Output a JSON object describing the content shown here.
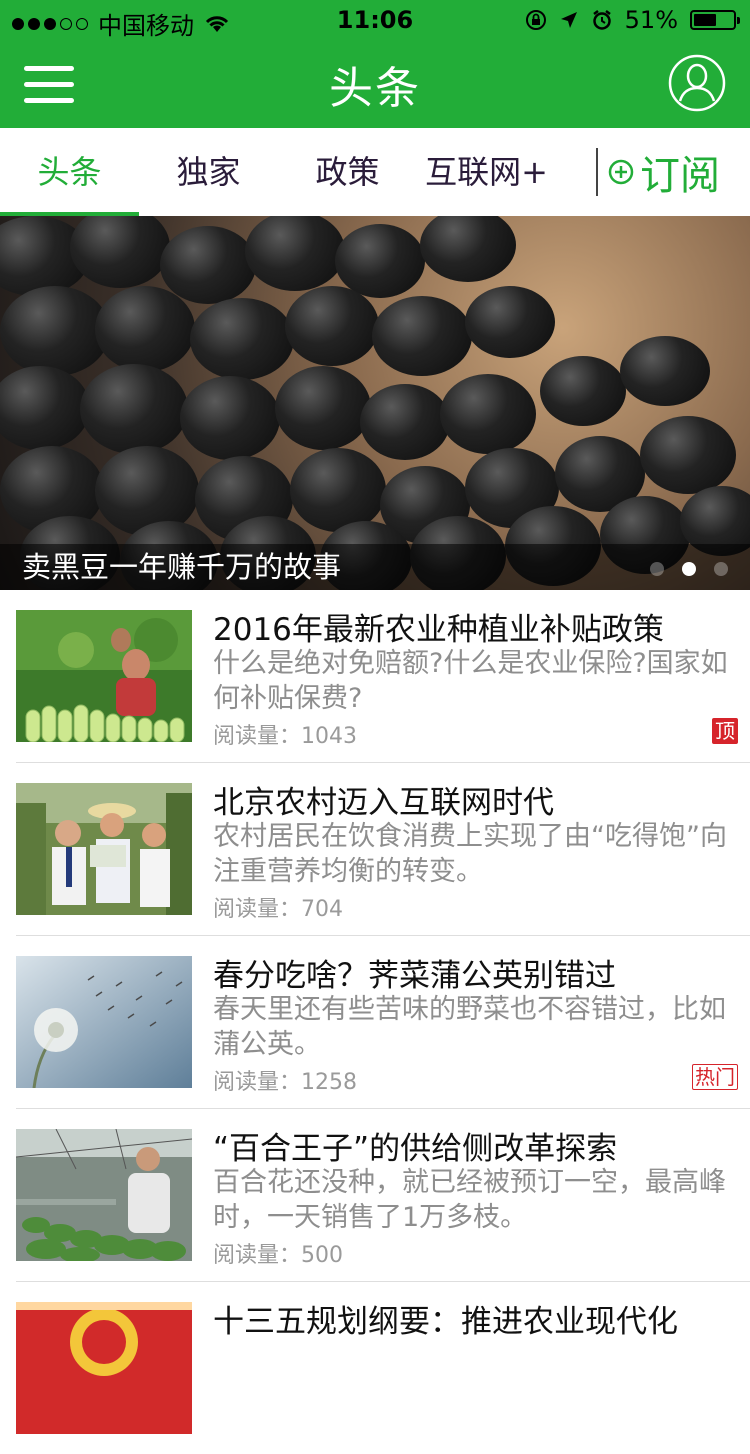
{
  "status": {
    "carrier": "中国移动",
    "time": "11:06",
    "battery": "51%"
  },
  "nav": {
    "title": "头条"
  },
  "tabs": [
    {
      "label": "头条",
      "active": true
    },
    {
      "label": "独家",
      "active": false
    },
    {
      "label": "政策",
      "active": false
    },
    {
      "label": "互联网+",
      "active": false
    }
  ],
  "subscribe_label": "订阅",
  "banner": {
    "caption": "卖黑豆一年赚千万的故事",
    "page_count": 3,
    "current_page": 2
  },
  "news": [
    {
      "title": "2016年最新农业种植业补贴政策",
      "summary": "什么是绝对免赔额?什么是农业保险?国家如何补贴保费?",
      "reads": "阅读量：1043",
      "tag": "顶"
    },
    {
      "title": "北京农村迈入互联网时代",
      "summary": "农村居民在饮食消费上实现了由“吃得饱”向注重营养均衡的转变。",
      "reads": "阅读量：704",
      "tag": ""
    },
    {
      "title": "春分吃啥？荠菜蒲公英别错过",
      "summary": "春天里还有些苦味的野菜也不容错过，比如蒲公英。",
      "reads": "阅读量：1258",
      "tag": "热门"
    },
    {
      "title": "“百合王子”的供给侧改革探索",
      "summary": "百合花还没种，就已经被预订一空，最高峰时，一天销售了1万多枝。",
      "reads": "阅读量：500",
      "tag": ""
    },
    {
      "title": "十三五规划纲要：推进农业现代化",
      "summary": "",
      "reads": "",
      "tag": ""
    }
  ],
  "colors": {
    "brand": "#22ad38",
    "tag": "#d6242b"
  }
}
